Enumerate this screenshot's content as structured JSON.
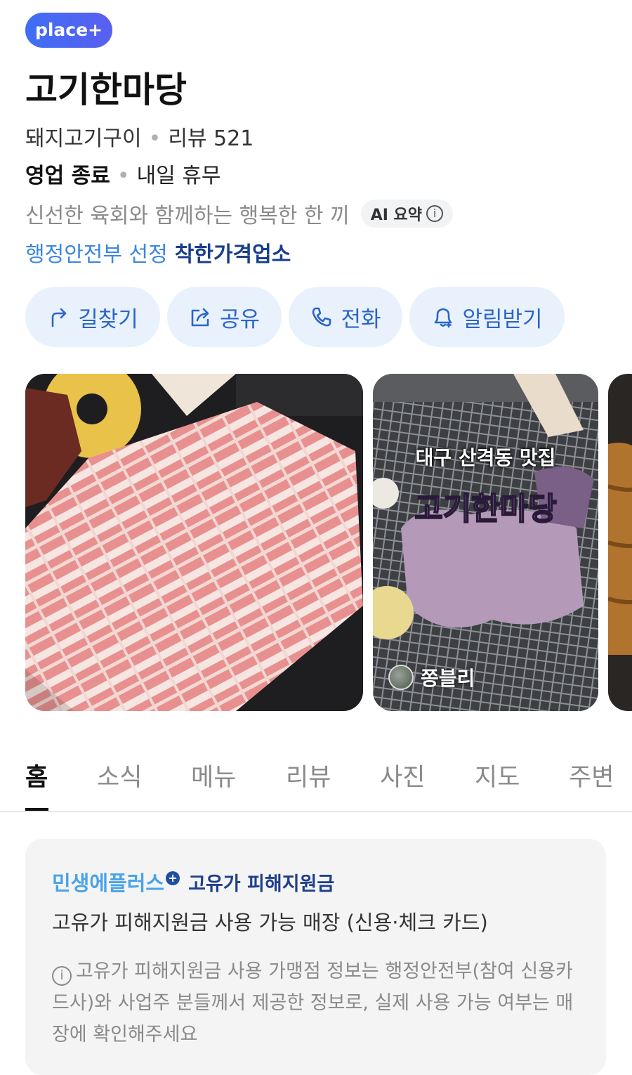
{
  "badge": "place+",
  "title": "고기한마당",
  "info": {
    "category": "돼지고기구이",
    "review": "리뷰 521",
    "status": "영업 종료",
    "status_note": "내일 휴무",
    "summary": "신선한 육회와 함께하는 행복한 한 끼",
    "ai_label": "AI 요약",
    "gov_label": "행정안전부 선정",
    "gov_highlight": "착한가격업소"
  },
  "actions": [
    {
      "label": "길찾기",
      "icon": "directions-icon"
    },
    {
      "label": "공유",
      "icon": "share-icon"
    },
    {
      "label": "전화",
      "icon": "phone-icon"
    },
    {
      "label": "알림받기",
      "icon": "bell-icon"
    }
  ],
  "photos": {
    "overlay_sub": "대구 산격동 맛집",
    "overlay_brand": "고기한마당",
    "author": "쫑블리"
  },
  "tabs": [
    "홈",
    "소식",
    "메뉴",
    "리뷰",
    "사진",
    "지도",
    "주변"
  ],
  "active_tab": "홈",
  "notice": {
    "brand": "민생에플러스",
    "brand_plus": "+",
    "title": "고유가 피해지원금",
    "subtitle": "고유가 피해지원금 사용 가능 매장 (신용·체크 카드)",
    "note": "고유가 피해지원금 사용 가맹점 정보는 행정안전부(참여 신용카드사)와 사업주 분들께서 제공한 정보로, 실제 사용 가능 여부는 매장에 확인해주세요"
  },
  "colors": {
    "accent_blue": "#2a66c9",
    "action_bg": "#e9f1fc",
    "badge": "#4a66f2",
    "gov_blue": "#3a86e0"
  }
}
